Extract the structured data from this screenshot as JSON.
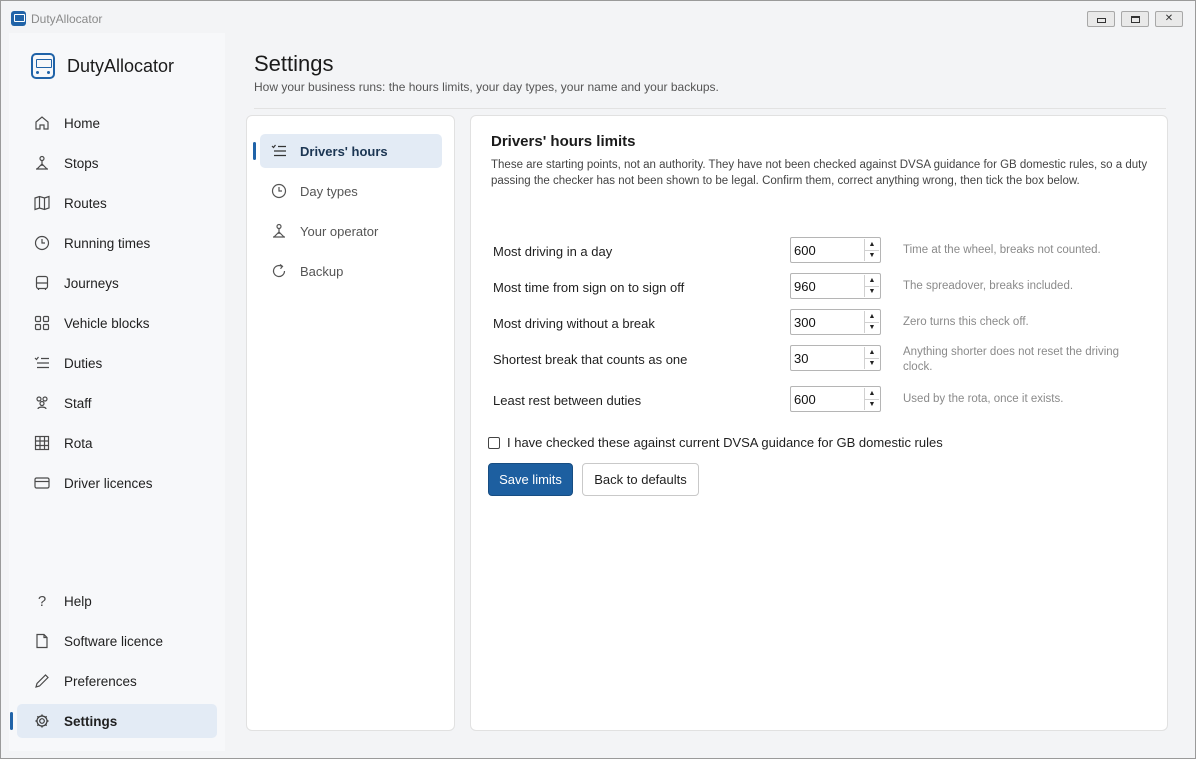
{
  "window": {
    "title": "DutyAllocator"
  },
  "sidebar": {
    "brand": "DutyAllocator",
    "items": [
      {
        "label": "Home",
        "icon": "home-icon"
      },
      {
        "label": "Stops",
        "icon": "stop-pin-icon"
      },
      {
        "label": "Routes",
        "icon": "map-icon"
      },
      {
        "label": "Running times",
        "icon": "clock-icon"
      },
      {
        "label": "Journeys",
        "icon": "bus-icon"
      },
      {
        "label": "Vehicle blocks",
        "icon": "grid-blocks-icon"
      },
      {
        "label": "Duties",
        "icon": "list-check-icon"
      },
      {
        "label": "Staff",
        "icon": "people-icon"
      },
      {
        "label": "Rota",
        "icon": "table-icon"
      },
      {
        "label": "Driver licences",
        "icon": "card-icon"
      }
    ],
    "bottom_items": [
      {
        "label": "Help",
        "icon": "question-icon"
      },
      {
        "label": "Software licence",
        "icon": "document-icon"
      },
      {
        "label": "Preferences",
        "icon": "pen-icon"
      },
      {
        "label": "Settings",
        "icon": "gear-icon",
        "active": true
      }
    ]
  },
  "header": {
    "title": "Settings",
    "subtitle": "How your business runs: the hours limits, your day types, your name and your backups."
  },
  "subnav": {
    "items": [
      {
        "label": "Drivers' hours",
        "icon": "list-check-icon",
        "active": true
      },
      {
        "label": "Day types",
        "icon": "clock-icon"
      },
      {
        "label": "Your operator",
        "icon": "operator-icon"
      },
      {
        "label": "Backup",
        "icon": "refresh-icon"
      }
    ]
  },
  "main": {
    "title": "Drivers' hours limits",
    "intro": "These are starting points, not an authority. They have not been checked against DVSA guidance for GB domestic rules, so a duty passing the checker has not been shown to be legal. Confirm them, correct anything wrong, then tick the box below.",
    "fields": [
      {
        "label": "Most driving in a day",
        "value": "600",
        "hint": "Time at the wheel, breaks not counted."
      },
      {
        "label": "Most time from sign on to sign off",
        "value": "960",
        "hint": "The spreadover, breaks included."
      },
      {
        "label": "Most driving without a break",
        "value": "300",
        "hint": "Zero turns this check off."
      },
      {
        "label": "Shortest break that counts as one",
        "value": "30",
        "hint": "Anything shorter does not reset the driving clock."
      },
      {
        "label": "Least rest between duties",
        "value": "600",
        "hint": "Used by the rota, once it exists."
      }
    ],
    "confirm_label": "I have checked these against current DVSA guidance for GB domestic rules",
    "confirm_checked": false,
    "save_label": "Save limits",
    "defaults_label": "Back to defaults"
  },
  "colors": {
    "accent": "#1d5fa0",
    "active_bg": "#e3ebf5"
  }
}
